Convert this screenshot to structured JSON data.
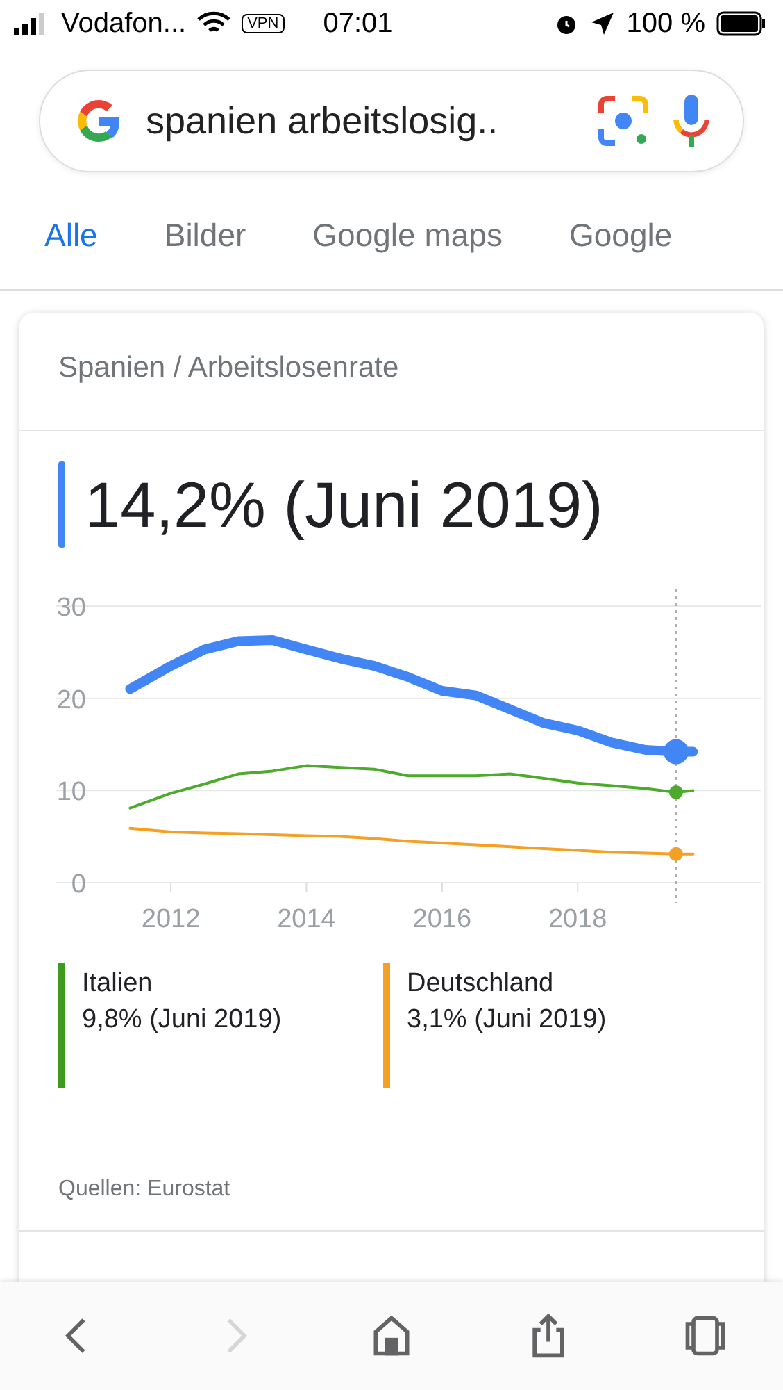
{
  "status_bar": {
    "carrier": "Vodafon...",
    "vpn": "VPN",
    "time": "07:01",
    "battery": "100 %"
  },
  "search": {
    "value": "spanien arbeitslosig.."
  },
  "tabs": [
    {
      "label": "Alle",
      "selected": true
    },
    {
      "label": "Bilder",
      "selected": false
    },
    {
      "label": "Google maps",
      "selected": false
    },
    {
      "label": "Google",
      "selected": false
    }
  ],
  "card": {
    "breadcrumb": "Spanien / Arbeitslosenrate",
    "headline": "14,2% (Juni 2019)",
    "chart_data": {
      "type": "line",
      "x": [
        2011.4,
        2012,
        2012.5,
        2013,
        2013.5,
        2014,
        2014.5,
        2015,
        2015.5,
        2016,
        2016.5,
        2017,
        2017.5,
        2018,
        2018.5,
        2019,
        2019.45,
        2019.7
      ],
      "xlim": [
        2010.3,
        2020.7
      ],
      "ylim": [
        0,
        30
      ],
      "yticks": [
        0,
        10,
        20,
        30
      ],
      "xticks": [
        2012,
        2014,
        2016,
        2018
      ],
      "ref_lines": [
        {
          "axis": "x",
          "value": 2019.45
        }
      ],
      "series": [
        {
          "color": "#4285f4",
          "values": [
            21,
            23.5,
            25.3,
            26.2,
            26.3,
            25.3,
            24.3,
            23.5,
            22.3,
            20.8,
            20.3,
            18.8,
            17.3,
            16.5,
            15.2,
            14.4,
            14.2,
            14.2
          ]
        },
        {
          "color": "#4caa2c",
          "values": [
            8.1,
            9.7,
            10.7,
            11.8,
            12.1,
            12.7,
            12.5,
            12.3,
            11.6,
            11.6,
            11.6,
            11.8,
            11.3,
            10.8,
            10.5,
            10.2,
            9.8,
            10.0
          ]
        },
        {
          "color": "#f4a024",
          "values": [
            5.9,
            5.5,
            5.4,
            5.3,
            5.2,
            5.1,
            5.0,
            4.8,
            4.5,
            4.3,
            4.1,
            3.9,
            3.7,
            3.5,
            3.3,
            3.2,
            3.1,
            3.1
          ]
        }
      ]
    },
    "legend": [
      {
        "name": "Italien",
        "reading": "9,8% (Juni 2019)",
        "color": "#3d9a1c"
      },
      {
        "name": "Deutschland",
        "reading": "3,1% (Juni 2019)",
        "color": "#f4a024"
      }
    ],
    "sources": "Quellen: Eurostat"
  },
  "toolbar": [
    {
      "kind": "back",
      "disabled": false
    },
    {
      "kind": "forward",
      "disabled": true
    },
    {
      "kind": "home",
      "disabled": false
    },
    {
      "kind": "share",
      "disabled": false
    },
    {
      "kind": "tabs",
      "disabled": false
    }
  ]
}
